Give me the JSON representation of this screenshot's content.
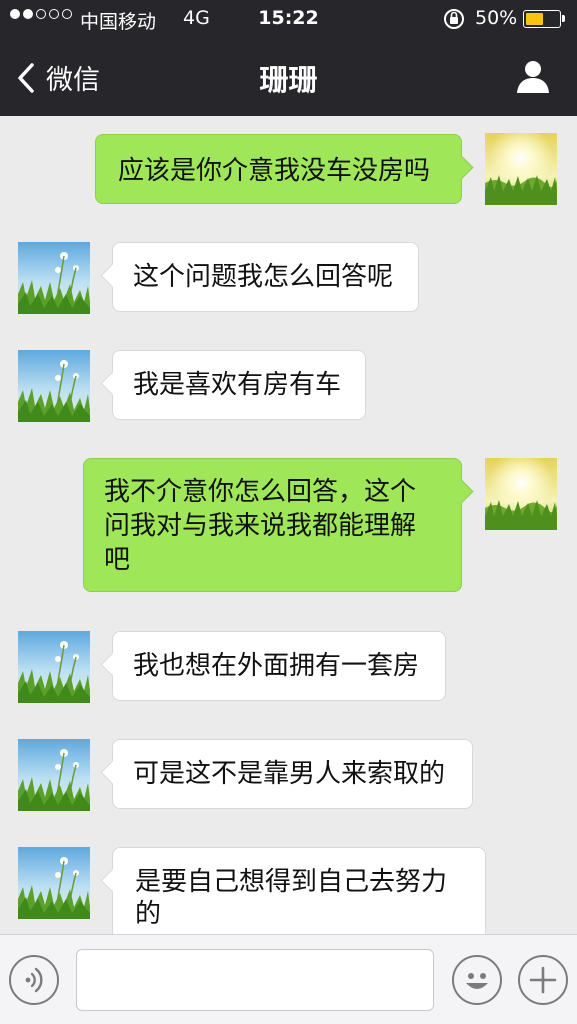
{
  "status_bar": {
    "carrier": "中国移动",
    "network": "4G",
    "time": "15:22",
    "battery": "50%",
    "battery_level": 0.5,
    "signal_bars": 2
  },
  "nav": {
    "back_label": "微信",
    "title": "珊珊",
    "profile_icon": "person-icon"
  },
  "messages": [
    {
      "side": "out",
      "text": "应该是你介意我没车没房吗"
    },
    {
      "side": "in",
      "text": "这个问题我怎么回答呢"
    },
    {
      "side": "in",
      "text": "我是喜欢有房有车"
    },
    {
      "side": "out",
      "text": "我不介意你怎么回答，这个问我对与我来说我都能理解吧"
    },
    {
      "side": "in",
      "text": "我也想在外面拥有一套房"
    },
    {
      "side": "in",
      "text": "可是这不是靠男人来索取的"
    },
    {
      "side": "in",
      "text": "是要自己想得到自己去努力的"
    }
  ],
  "input_bar": {
    "voice_icon": "voice-icon",
    "emoji_icon": "emoji-icon",
    "plus_icon": "plus-icon",
    "text": ""
  },
  "colors": {
    "bar_bg": "#27272b",
    "chat_bg": "#ebebeb",
    "bubble_out": "#9fe658",
    "bubble_in": "#ffffff",
    "battery_fill": "#f6c317"
  }
}
